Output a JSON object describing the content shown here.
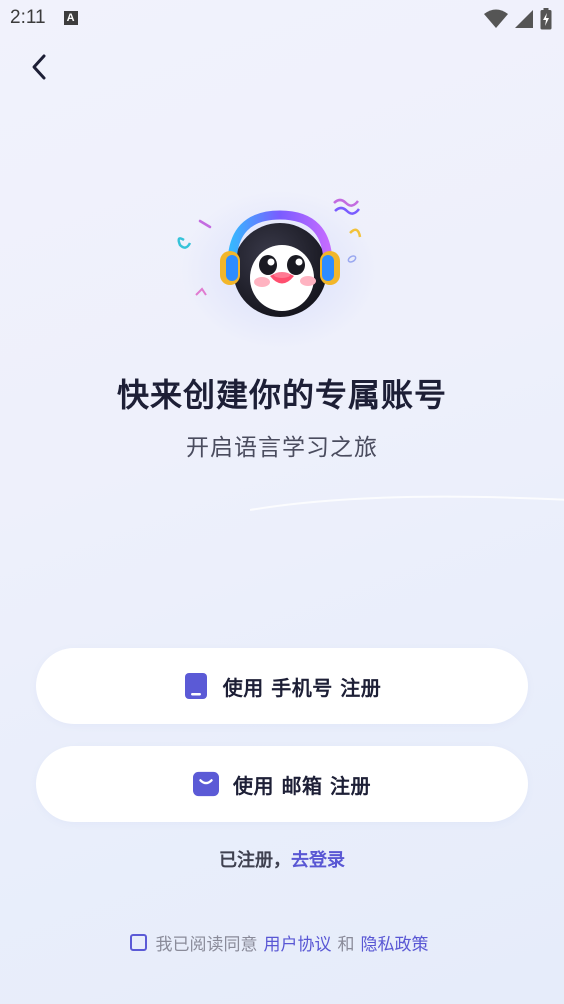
{
  "status_bar": {
    "time": "2:11",
    "notification_icon": "A"
  },
  "header": {
    "back_icon": "chevron-left-icon"
  },
  "hero": {
    "title": "快来创建你的专属账号",
    "subtitle": "开启语言学习之旅"
  },
  "actions": {
    "phone_register_label": "使用 手机号 注册",
    "email_register_label": "使用 邮箱 注册"
  },
  "login": {
    "prefix": "已注册，",
    "link": "去登录"
  },
  "agreement": {
    "text": "我已阅读同意",
    "user_agreement": "用户协议",
    "conjunction": "和",
    "privacy_policy": "隐私政策",
    "checked": false
  },
  "colors": {
    "accent": "#5957d4",
    "button_icon": "#5b5ad6",
    "title": "#1d1f36"
  }
}
